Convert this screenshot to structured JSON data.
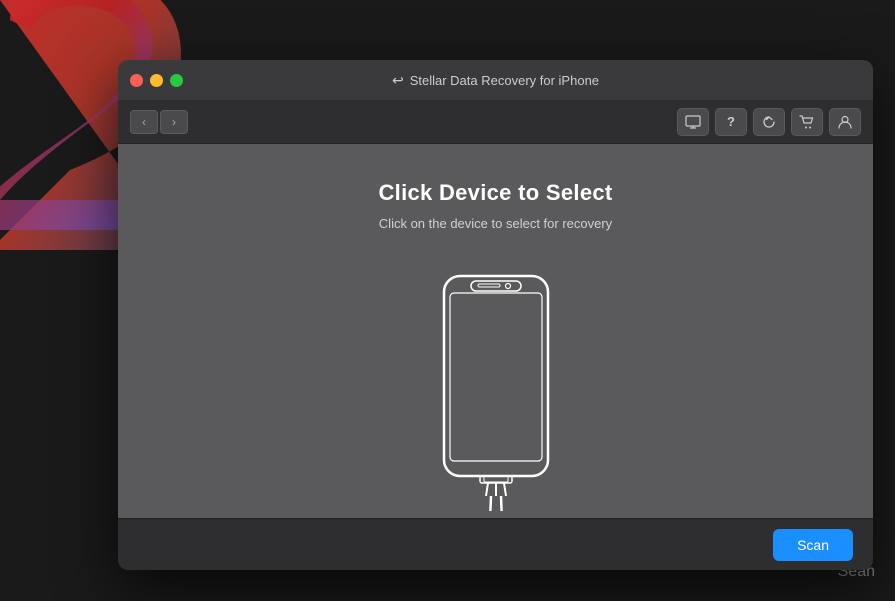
{
  "window": {
    "title": "Stellar Data Recovery for iPhone",
    "title_icon": "↩"
  },
  "traffic_lights": {
    "close": "close",
    "minimize": "minimize",
    "maximize": "maximize"
  },
  "nav": {
    "back_label": "‹",
    "forward_label": "›"
  },
  "toolbar": {
    "buttons": [
      {
        "icon": "⊟",
        "name": "toolbar-btn-1"
      },
      {
        "icon": "?",
        "name": "toolbar-btn-help"
      },
      {
        "icon": "↻",
        "name": "toolbar-btn-refresh"
      },
      {
        "icon": "🛒",
        "name": "toolbar-btn-cart"
      },
      {
        "icon": "👤",
        "name": "toolbar-btn-user"
      }
    ]
  },
  "main": {
    "title": "Click Device to Select",
    "subtitle": "Click on the device to select for recovery"
  },
  "bottom": {
    "scan_button_label": "Scan"
  },
  "decoration": {
    "sean_label": "Sean"
  }
}
